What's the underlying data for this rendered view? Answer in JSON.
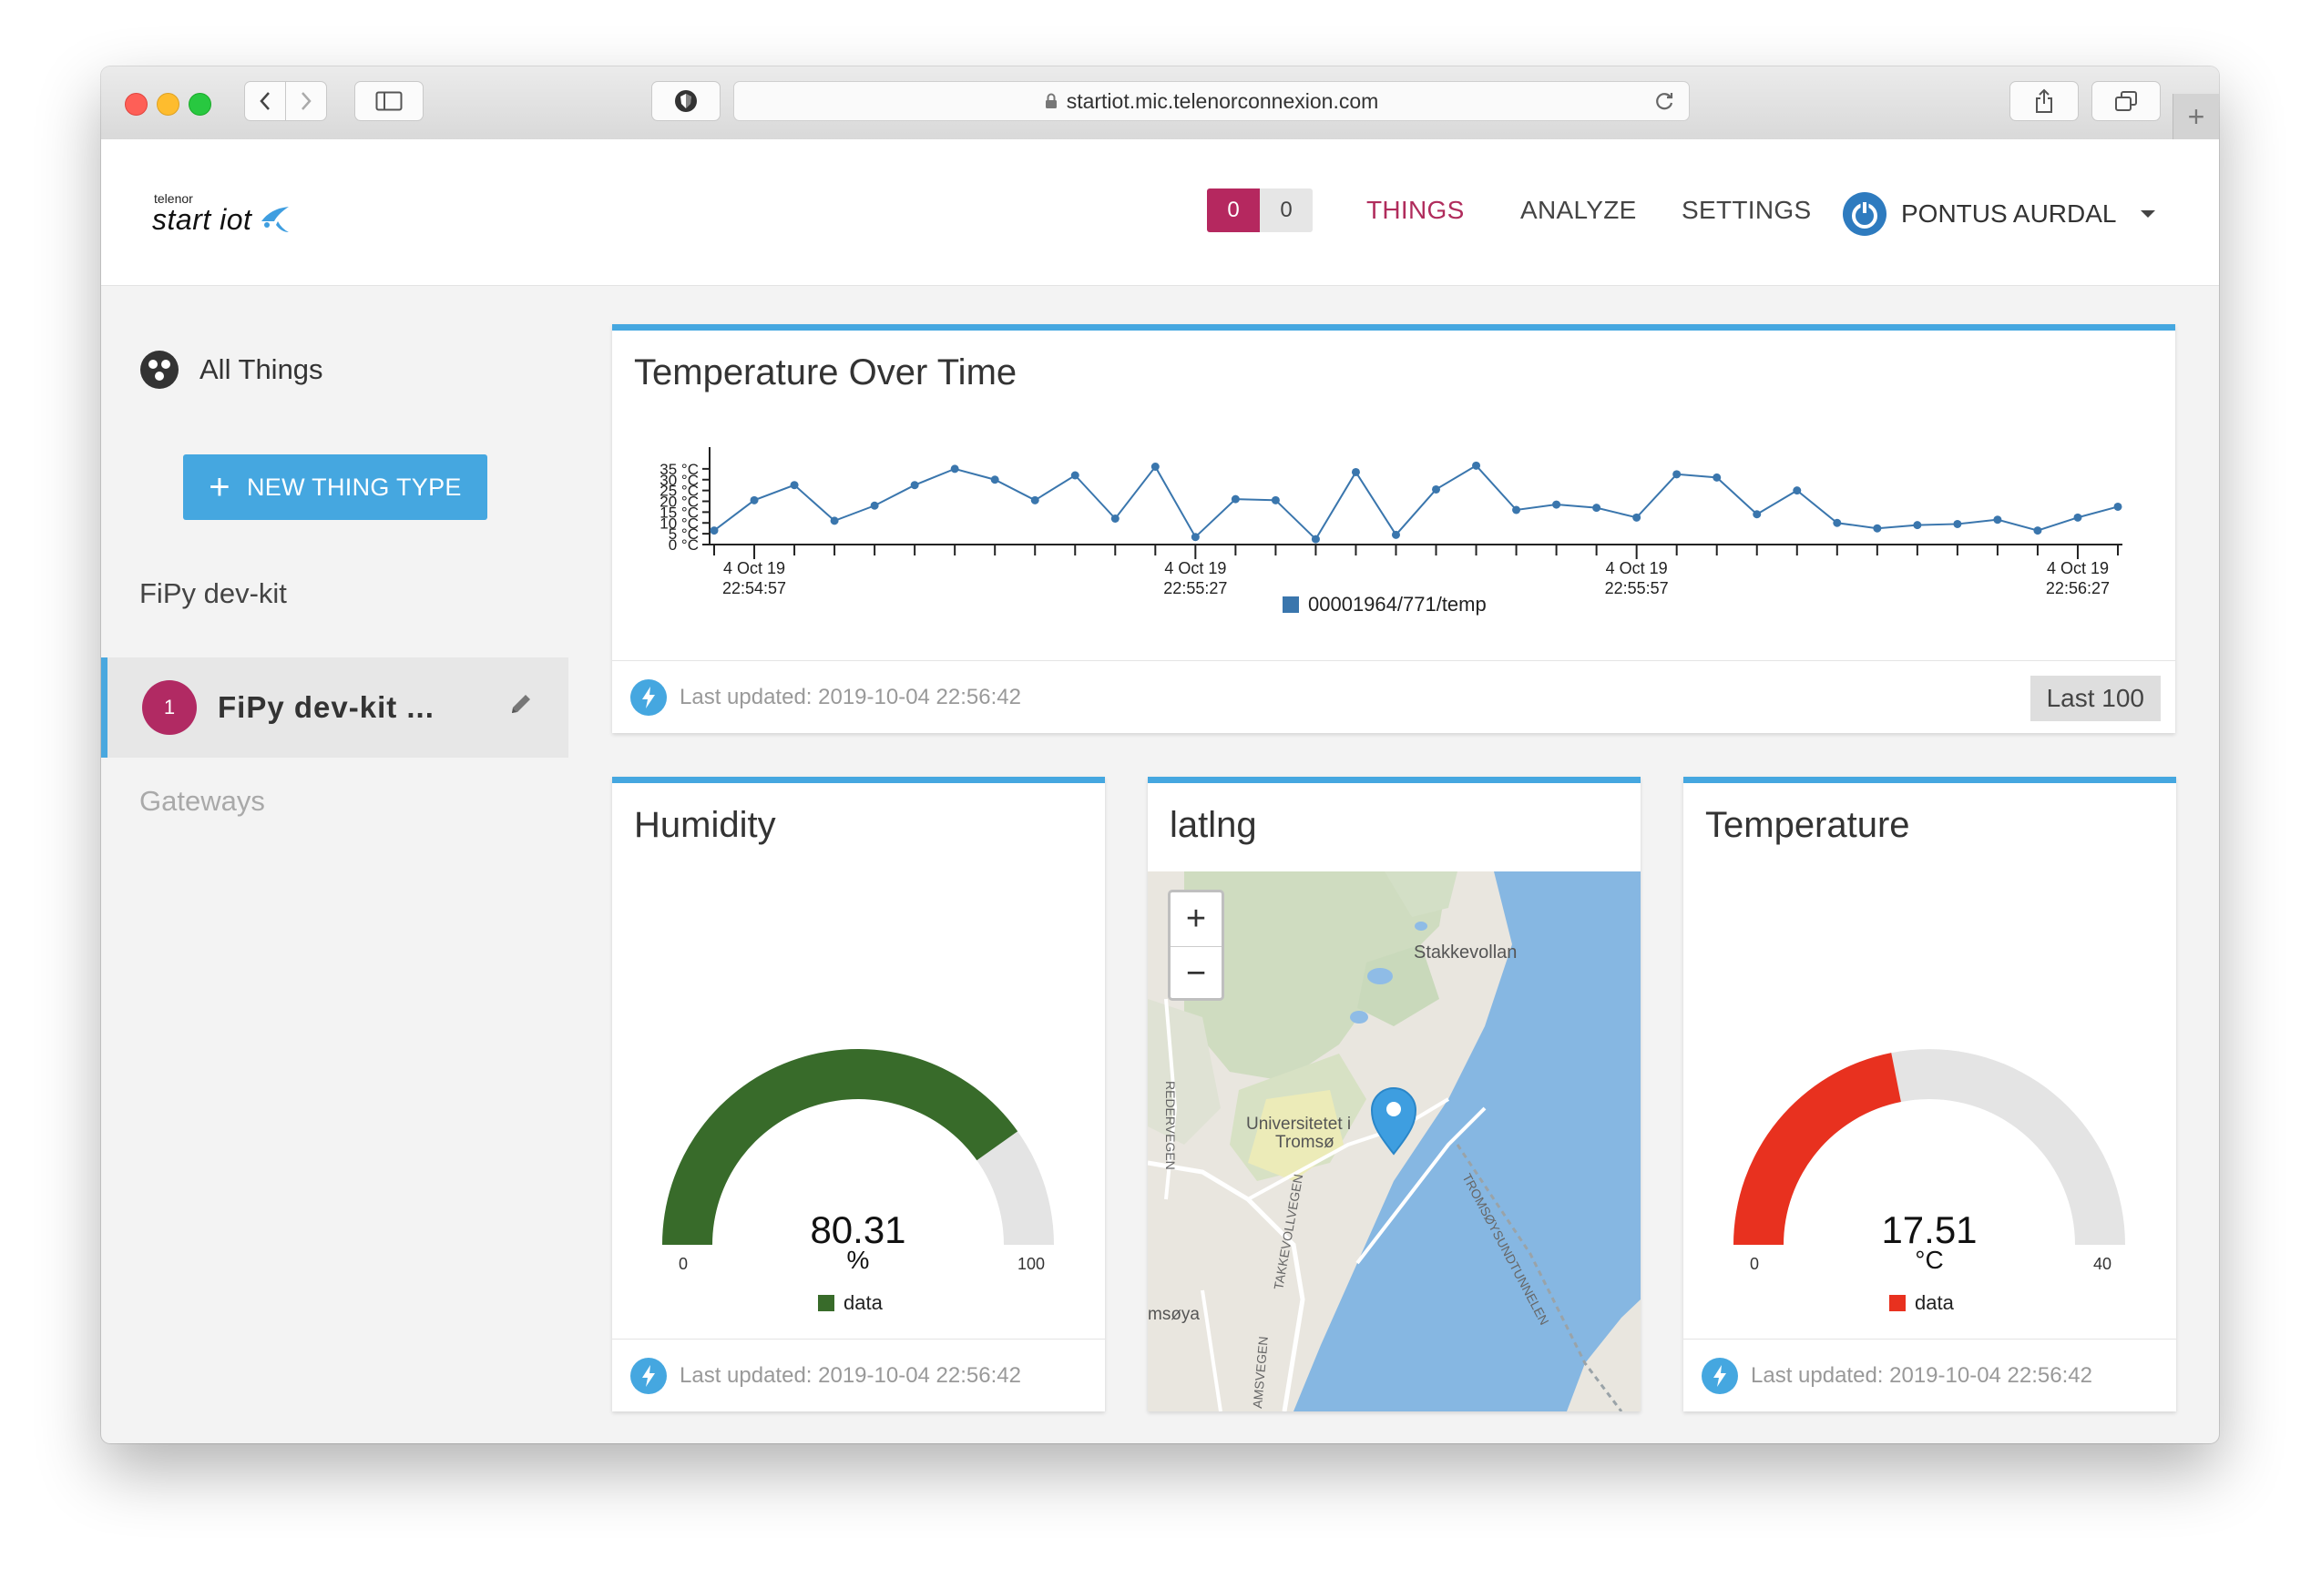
{
  "browser": {
    "url": "startiot.mic.telenorconnexion.com"
  },
  "header": {
    "logo_small": "telenor",
    "logo_main": "start iot",
    "counter_left": "0",
    "counter_right": "0",
    "nav": [
      "THINGS",
      "ANALYZE",
      "SETTINGS"
    ],
    "user_name": "PONTUS AURDAL",
    "accent_color": "#b02c5c"
  },
  "sidebar": {
    "all_things": "All Things",
    "new_button": "NEW THING TYPE",
    "section_heading": "FiPy dev-kit",
    "active_item": {
      "badge": "1",
      "name": "FiPy dev-kit ..."
    },
    "gateways": "Gateways"
  },
  "temp_card": {
    "title": "Temperature Over Time",
    "footer": "Last updated: 2019-10-04 22:56:42",
    "range_button": "Last 100",
    "chart_data": {
      "type": "line",
      "title": "Temperature Over Time",
      "series": [
        {
          "name": "00001964/771/temp",
          "color": "#3a76ad",
          "values": [
            6.5,
            20.5,
            27.5,
            11,
            18,
            27.5,
            35,
            30,
            20.5,
            32,
            12,
            36,
            3.5,
            21,
            20.5,
            2.5,
            33.5,
            4.5,
            25.5,
            36.5,
            16,
            18.5,
            17,
            12.5,
            32.5,
            31,
            14,
            25,
            10,
            7.5,
            9,
            9.5,
            11.5,
            6.5,
            12.5,
            17.5
          ]
        }
      ],
      "yticks": [
        "0 °C",
        "5 °C",
        "10 °C",
        "15 °C",
        "20 °C",
        "25 °C",
        "30 °C",
        "35 °C"
      ],
      "ylim": [
        0,
        40
      ],
      "xtick_labels": [
        [
          "4 Oct 19",
          "22:54:57"
        ],
        [
          "4 Oct 19",
          "22:55:27"
        ],
        [
          "4 Oct 19",
          "22:55:57"
        ],
        [
          "4 Oct 19",
          "22:56:27"
        ]
      ],
      "xlabel": "",
      "ylabel": "",
      "legend": "bottom"
    }
  },
  "humidity_card": {
    "title": "Humidity",
    "value": "80.31",
    "unit": "%",
    "min": "0",
    "max": "100",
    "legend": "data",
    "color": "#386b2a",
    "level": 80.31,
    "footer": "Last updated: 2019-10-04 22:56:42"
  },
  "map_card": {
    "title": "latlng",
    "zoom_in": "+",
    "zoom_out": "−",
    "labels": [
      "Stakkevollan",
      "Universitetet i",
      "Tromsø",
      "REDERVEGEN",
      "TROMSØYSUNDTUNNELEN",
      "msøya",
      "TAKKEVOLLVEGEN",
      "AMSVEGEN"
    ]
  },
  "temperature_card": {
    "title": "Temperature",
    "value": "17.51",
    "unit": "°C",
    "min": "0",
    "max": "40",
    "legend": "data",
    "color": "#e8311f",
    "level": 17.51,
    "range_max": 40,
    "footer": "Last updated: 2019-10-04 22:56:42"
  }
}
